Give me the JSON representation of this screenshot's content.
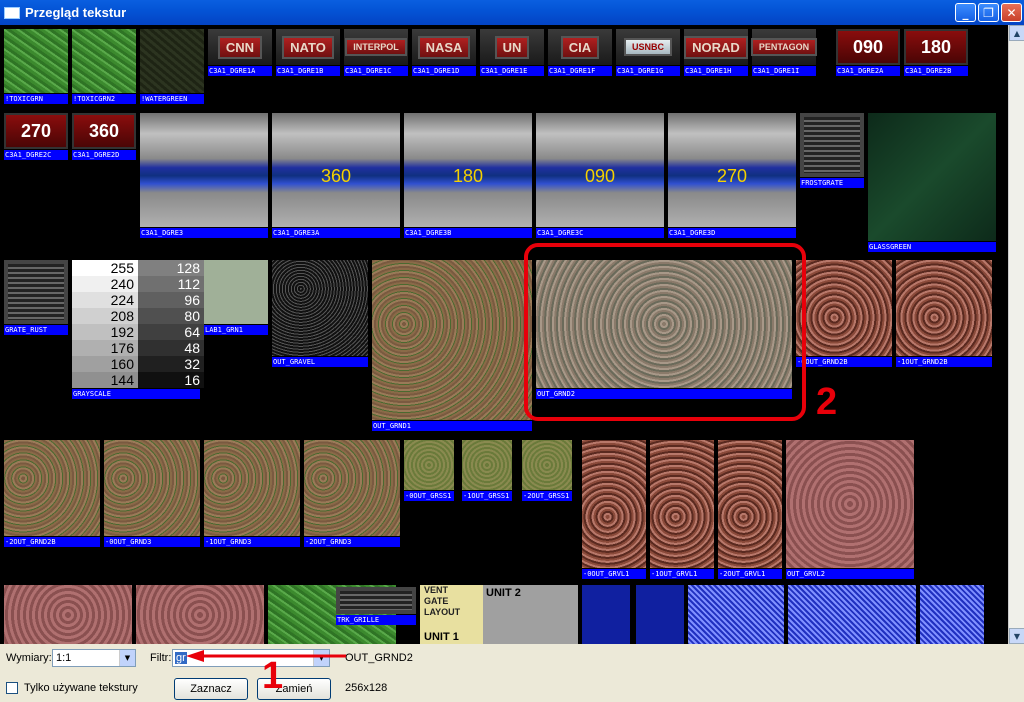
{
  "window": {
    "title": "Przegląd tekstur"
  },
  "textures_row1": [
    {
      "name": "!TOXICGRN"
    },
    {
      "name": "!TOXICGRN2"
    },
    {
      "name": "!WATERGREEN"
    },
    {
      "name": "C3A1_DGRE1A",
      "sign": "CNN"
    },
    {
      "name": "C3A1_DGRE1B",
      "sign": "NATO"
    },
    {
      "name": "C3A1_DGRE1C",
      "sign": "INTERPOL"
    },
    {
      "name": "C3A1_DGRE1D",
      "sign": "NASA"
    },
    {
      "name": "C3A1_DGRE1E",
      "sign": "UN"
    },
    {
      "name": "C3A1_DGRE1F",
      "sign": "CIA"
    },
    {
      "name": "C3A1_DGRE1G",
      "sign": "USNBC"
    },
    {
      "name": "C3A1_DGRE1H",
      "sign": "NORAD"
    },
    {
      "name": "C3A1_DGRE1I",
      "sign": "PENTAGON"
    },
    {
      "name": "C3A1_DGRE2A",
      "sign": "090"
    },
    {
      "name": "C3A1_DGRE2B",
      "sign": "180"
    }
  ],
  "textures_row2": [
    {
      "name": "C3A1_DGRE2C",
      "sign": "270"
    },
    {
      "name": "C3A1_DGRE2D",
      "sign": "360"
    },
    {
      "name": "C3A1_DGRE3"
    },
    {
      "name": "C3A1_DGRE3A",
      "sign": "360"
    },
    {
      "name": "C3A1_DGRE3B",
      "sign": "180"
    },
    {
      "name": "C3A1_DGRE3C",
      "sign": "090"
    },
    {
      "name": "C3A1_DGRE3D",
      "sign": "270"
    },
    {
      "name": "FROSTGRATE"
    },
    {
      "name": "GLASSGREEN"
    }
  ],
  "textures_row3": [
    {
      "name": "GRATE_RUST"
    },
    {
      "name": "GRAYSCALE"
    },
    {
      "name": "LAB1_GRN1"
    },
    {
      "name": "OUT_GRAVEL"
    },
    {
      "name": "OUT_GRND1"
    },
    {
      "name": "OUT_GRND2"
    },
    {
      "name": "-0OUT_GRND2B"
    },
    {
      "name": "-1OUT_GRND2B"
    }
  ],
  "grayscale_values": [
    "255",
    "128",
    "240",
    "112",
    "224",
    "96",
    "208",
    "80",
    "192",
    "64",
    "176",
    "48",
    "160",
    "32",
    "144",
    "16"
  ],
  "textures_row4": [
    {
      "name": "-2OUT_GRND2B"
    },
    {
      "name": "-0OUT_GRND3"
    },
    {
      "name": "-1OUT_GRND3"
    },
    {
      "name": "-2OUT_GRND3"
    },
    {
      "name": "-0OUT_GRSS1"
    },
    {
      "name": "-1OUT_GRSS1"
    },
    {
      "name": "-2OUT_GRSS1"
    },
    {
      "name": "-0OUT_GRVL1"
    },
    {
      "name": "-1OUT_GRVL1"
    },
    {
      "name": "-2OUT_GRVL1"
    },
    {
      "name": "OUT_GRVL2"
    }
  ],
  "textures_row5": [
    {
      "name": "TRK_GRILLE"
    }
  ],
  "layout_tile": {
    "lines": [
      "VENT",
      "GATE",
      "LAYOUT",
      "UNIT 1",
      "UNIT 2"
    ]
  },
  "annotations": {
    "one": "1",
    "two": "2"
  },
  "controls": {
    "size_label": "Wymiary:",
    "size_value": "1:1",
    "filter_label": "Filtr:",
    "filter_value": "gr",
    "selected_texture": "OUT_GRND2",
    "only_used_label": "Tylko używane tekstury",
    "select_button": "Zaznacz",
    "replace_button": "Zamień",
    "dimensions": "256x128"
  }
}
